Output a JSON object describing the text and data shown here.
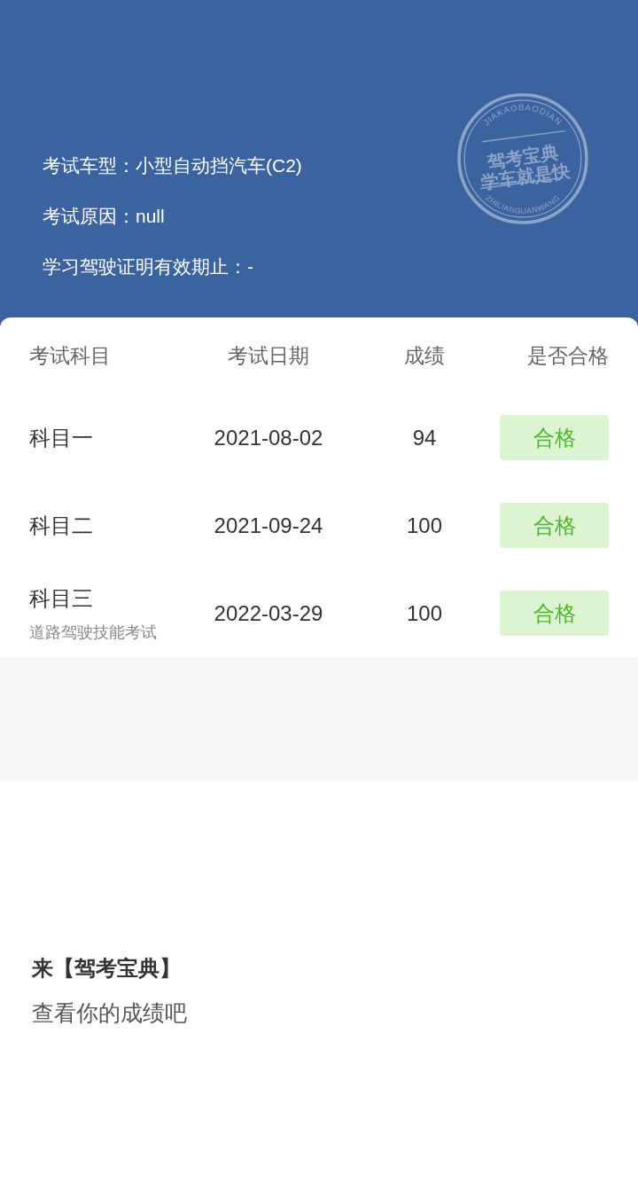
{
  "header": {
    "fields": [
      {
        "label": "考试车型：",
        "value": "小型自动挡汽车(C2)"
      },
      {
        "label": "考试原因：",
        "value": "null"
      },
      {
        "label": "学习驾驶证明有效期止：",
        "value": "-"
      }
    ],
    "stamp": {
      "top_arc": "JIAKAOBAODIAN",
      "line_1": "驾考宝典",
      "line_2": "学车就是快",
      "bottom_arc": "ZHILIANGUANWANG"
    }
  },
  "table": {
    "columns": [
      "考试科目",
      "考试日期",
      "成绩",
      "是否合格"
    ],
    "rows": [
      {
        "subject": "科目一",
        "date": "2021-08-02",
        "score": "94",
        "result": "合格",
        "passed": true
      },
      {
        "subject": "科目二",
        "date": "2021-09-24",
        "score": "100",
        "result": "合格",
        "passed": true
      },
      {
        "subject": "科目三",
        "note": "道路驾驶技能考试",
        "date": "2022-03-29",
        "score": "100",
        "result": "合格",
        "passed": true
      }
    ]
  },
  "footer": {
    "title": "来【驾考宝典】",
    "subtitle": "查看你的成绩吧"
  }
}
